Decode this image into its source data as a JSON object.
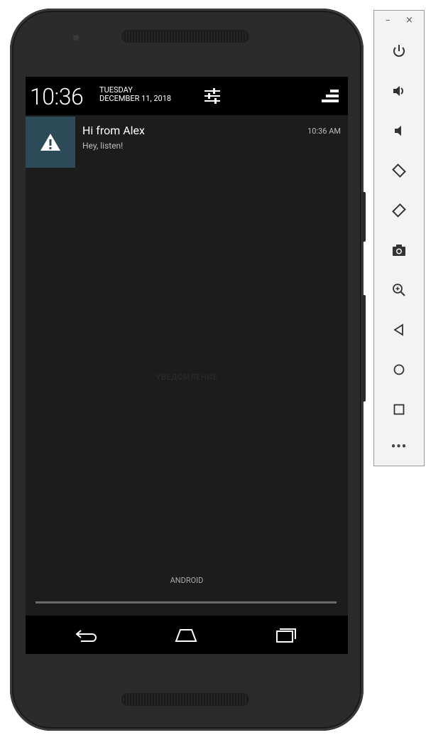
{
  "status_bar": {
    "time": "10:36",
    "day": "TUESDAY",
    "date": "DECEMBER 11, 2018"
  },
  "notification": {
    "title": "Hi from Alex",
    "text": "Hey, listen!",
    "time": "10:36 AM",
    "icon": "warning-icon"
  },
  "shade": {
    "empty_label": "УВЕДОМЛЕНИЕ",
    "carrier": "ANDROID"
  },
  "nav_bar": {
    "icons": [
      "back-icon",
      "home-icon",
      "recents-icon"
    ]
  },
  "toolbar": {
    "minimize": "–",
    "close": "×",
    "tools": [
      "power-icon",
      "volume-up-icon",
      "volume-down-icon",
      "rotate-left-icon",
      "rotate-right-icon",
      "camera-icon",
      "zoom-icon",
      "back-icon",
      "home-icon",
      "overview-icon",
      "more-icon"
    ],
    "more_label": "•••"
  },
  "colors": {
    "notification_accent": "#2c4a57",
    "screen_bg": "#1c1c1c",
    "status_bg": "#000000",
    "phone_body": "#2b2b2b"
  }
}
